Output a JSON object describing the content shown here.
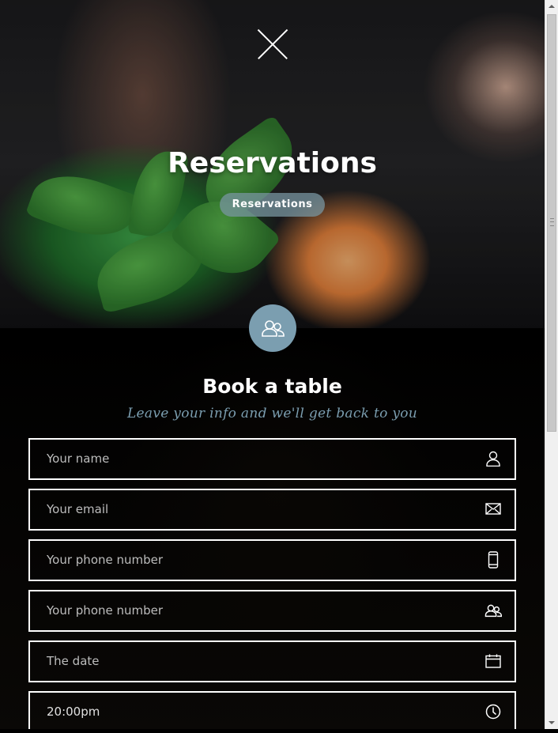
{
  "hero": {
    "title": "Reservations",
    "breadcrumb": "Reservations"
  },
  "form": {
    "title": "Book a table",
    "subtitle": "Leave your info and we'll get back to you",
    "fields": [
      {
        "text": "Your name",
        "icon": "user-icon"
      },
      {
        "text": "Your email",
        "icon": "envelope-icon"
      },
      {
        "text": "Your phone number",
        "icon": "phone-icon"
      },
      {
        "text": "Your phone number",
        "icon": "users-icon"
      },
      {
        "text": "The date",
        "icon": "calendar-icon"
      },
      {
        "text": "20:00pm",
        "icon": "clock-icon"
      }
    ]
  },
  "colors": {
    "accent": "#7b9eb0",
    "background": "#000000",
    "text": "#ffffff"
  }
}
